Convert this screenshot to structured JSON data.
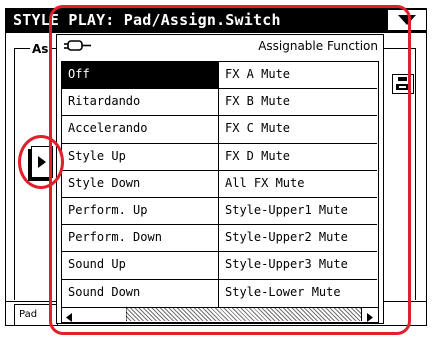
{
  "window": {
    "title": "STYLE PLAY: Pad/Assign.Switch"
  },
  "background": {
    "group_label": "As",
    "bottom_tab_label": "Pad"
  },
  "popup": {
    "header_title": "Assignable Function",
    "selected_row": 0,
    "rows": [
      {
        "col1": "Off",
        "col2": "FX A Mute"
      },
      {
        "col1": "Ritardando",
        "col2": "FX B Mute"
      },
      {
        "col1": "Accelerando",
        "col2": "FX C Mute"
      },
      {
        "col1": "Style Up",
        "col2": "FX D Mute"
      },
      {
        "col1": "Style Down",
        "col2": "All FX Mute"
      },
      {
        "col1": "Perform. Up",
        "col2": "Style-Upper1 Mute"
      },
      {
        "col1": "Perform. Down",
        "col2": "Style-Upper2 Mute"
      },
      {
        "col1": "Sound Up",
        "col2": "Style-Upper3 Mute"
      },
      {
        "col1": "Sound Down",
        "col2": "Style-Lower Mute"
      }
    ],
    "scroll_position": 0
  },
  "icons": {
    "menu": "triangle-down-icon",
    "plug": "plug-icon",
    "nav": "arrow-right-icon",
    "save": "save-icon"
  },
  "colors": {
    "highlight": "#e0202a",
    "selection": "#000000"
  }
}
